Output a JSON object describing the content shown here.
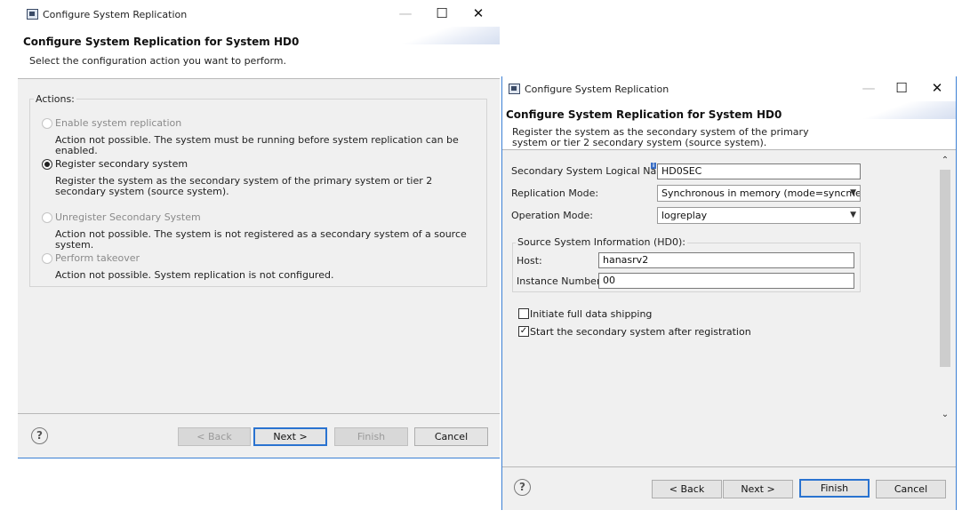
{
  "left_dialog": {
    "window_title": "Configure System Replication",
    "heading": "Configure System Replication for System HD0",
    "description": "Select the configuration action you want to perform.",
    "actions_group_label": "Actions:",
    "options": [
      {
        "label": "Enable system replication",
        "description": "Action not possible. The system must be running before system replication can be enabled.",
        "enabled": false,
        "selected": false
      },
      {
        "label": "Register secondary system",
        "description": "Register the system as the secondary system of the primary system or tier 2 secondary system (source system).",
        "enabled": true,
        "selected": true
      },
      {
        "label": "Unregister Secondary System",
        "description": "Action not possible. The system is not registered as a secondary system of a source system.",
        "enabled": false,
        "selected": false
      },
      {
        "label": "Perform takeover",
        "description": "Action not possible. System replication is not configured.",
        "enabled": false,
        "selected": false
      }
    ],
    "buttons": {
      "back": "< Back",
      "next": "Next >",
      "finish": "Finish",
      "cancel": "Cancel"
    }
  },
  "right_dialog": {
    "window_title": "Configure System Replication",
    "heading": "Configure System Replication for System HD0",
    "description": "Register the system as the secondary system of the primary system or tier 2 secondary system (source system).",
    "fields": {
      "logical_name_label": "Secondary System Logical Name:",
      "logical_name_value": "HD0SEC",
      "replication_mode_label": "Replication Mode:",
      "replication_mode_value": "Synchronous in memory (mode=syncmem)",
      "operation_mode_label": "Operation Mode:",
      "operation_mode_value": "logreplay"
    },
    "source_group": {
      "label": "Source System Information (HD0):",
      "host_label": "Host:",
      "host_value": "hanasrv2",
      "instance_label": "Instance Number:",
      "instance_value": "00"
    },
    "checkboxes": [
      {
        "label": "Initiate full data shipping",
        "checked": false
      },
      {
        "label": "Start the secondary system after registration",
        "checked": true
      }
    ],
    "buttons": {
      "back": "< Back",
      "next": "Next >",
      "finish": "Finish",
      "cancel": "Cancel"
    }
  },
  "icons": {
    "help": "help-icon",
    "minimize": "minimize-icon",
    "maximize": "maximize-icon",
    "close": "close-icon",
    "app": "app-icon",
    "info": "info-icon",
    "dropdown": "chevron-down-icon",
    "scroll_up": "chevron-up-icon",
    "scroll_down": "chevron-down-icon"
  },
  "colors": {
    "accent": "#2a73d0",
    "dialog_background": "#f0f0f0"
  }
}
